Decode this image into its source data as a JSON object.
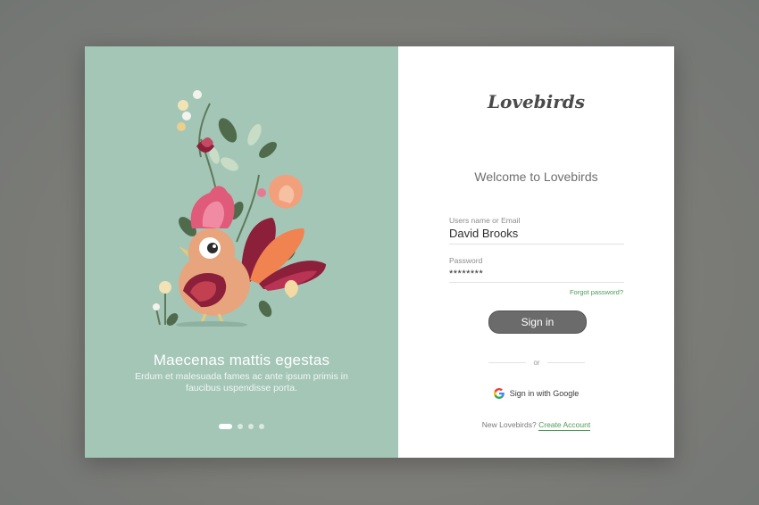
{
  "brand": {
    "name": "Lovebirds"
  },
  "onboarding": {
    "title": "Maecenas mattis egestas",
    "text": "Erdum et malesuada fames ac ante ipsum primis in faucibus uspendisse porta.",
    "dots_total": 4,
    "dots_active": 1
  },
  "login": {
    "welcome": "Welcome to Lovebirds",
    "username_label": "Users name or Email",
    "username_value": "David Brooks",
    "password_label": "Password",
    "password_value": "********",
    "forgot_label": "Forgot password?",
    "signin_label": "Sign in",
    "or_label": "or",
    "google_label": "Sign in with Google",
    "new_prompt": "New Lovebirds?",
    "create_label": "Create Account"
  },
  "colors": {
    "left_panel": "#a4c6b7",
    "accent_green": "#4f9a57",
    "button": "#6b6b6b"
  },
  "icons": [
    "bird-illustration",
    "google-icon"
  ]
}
